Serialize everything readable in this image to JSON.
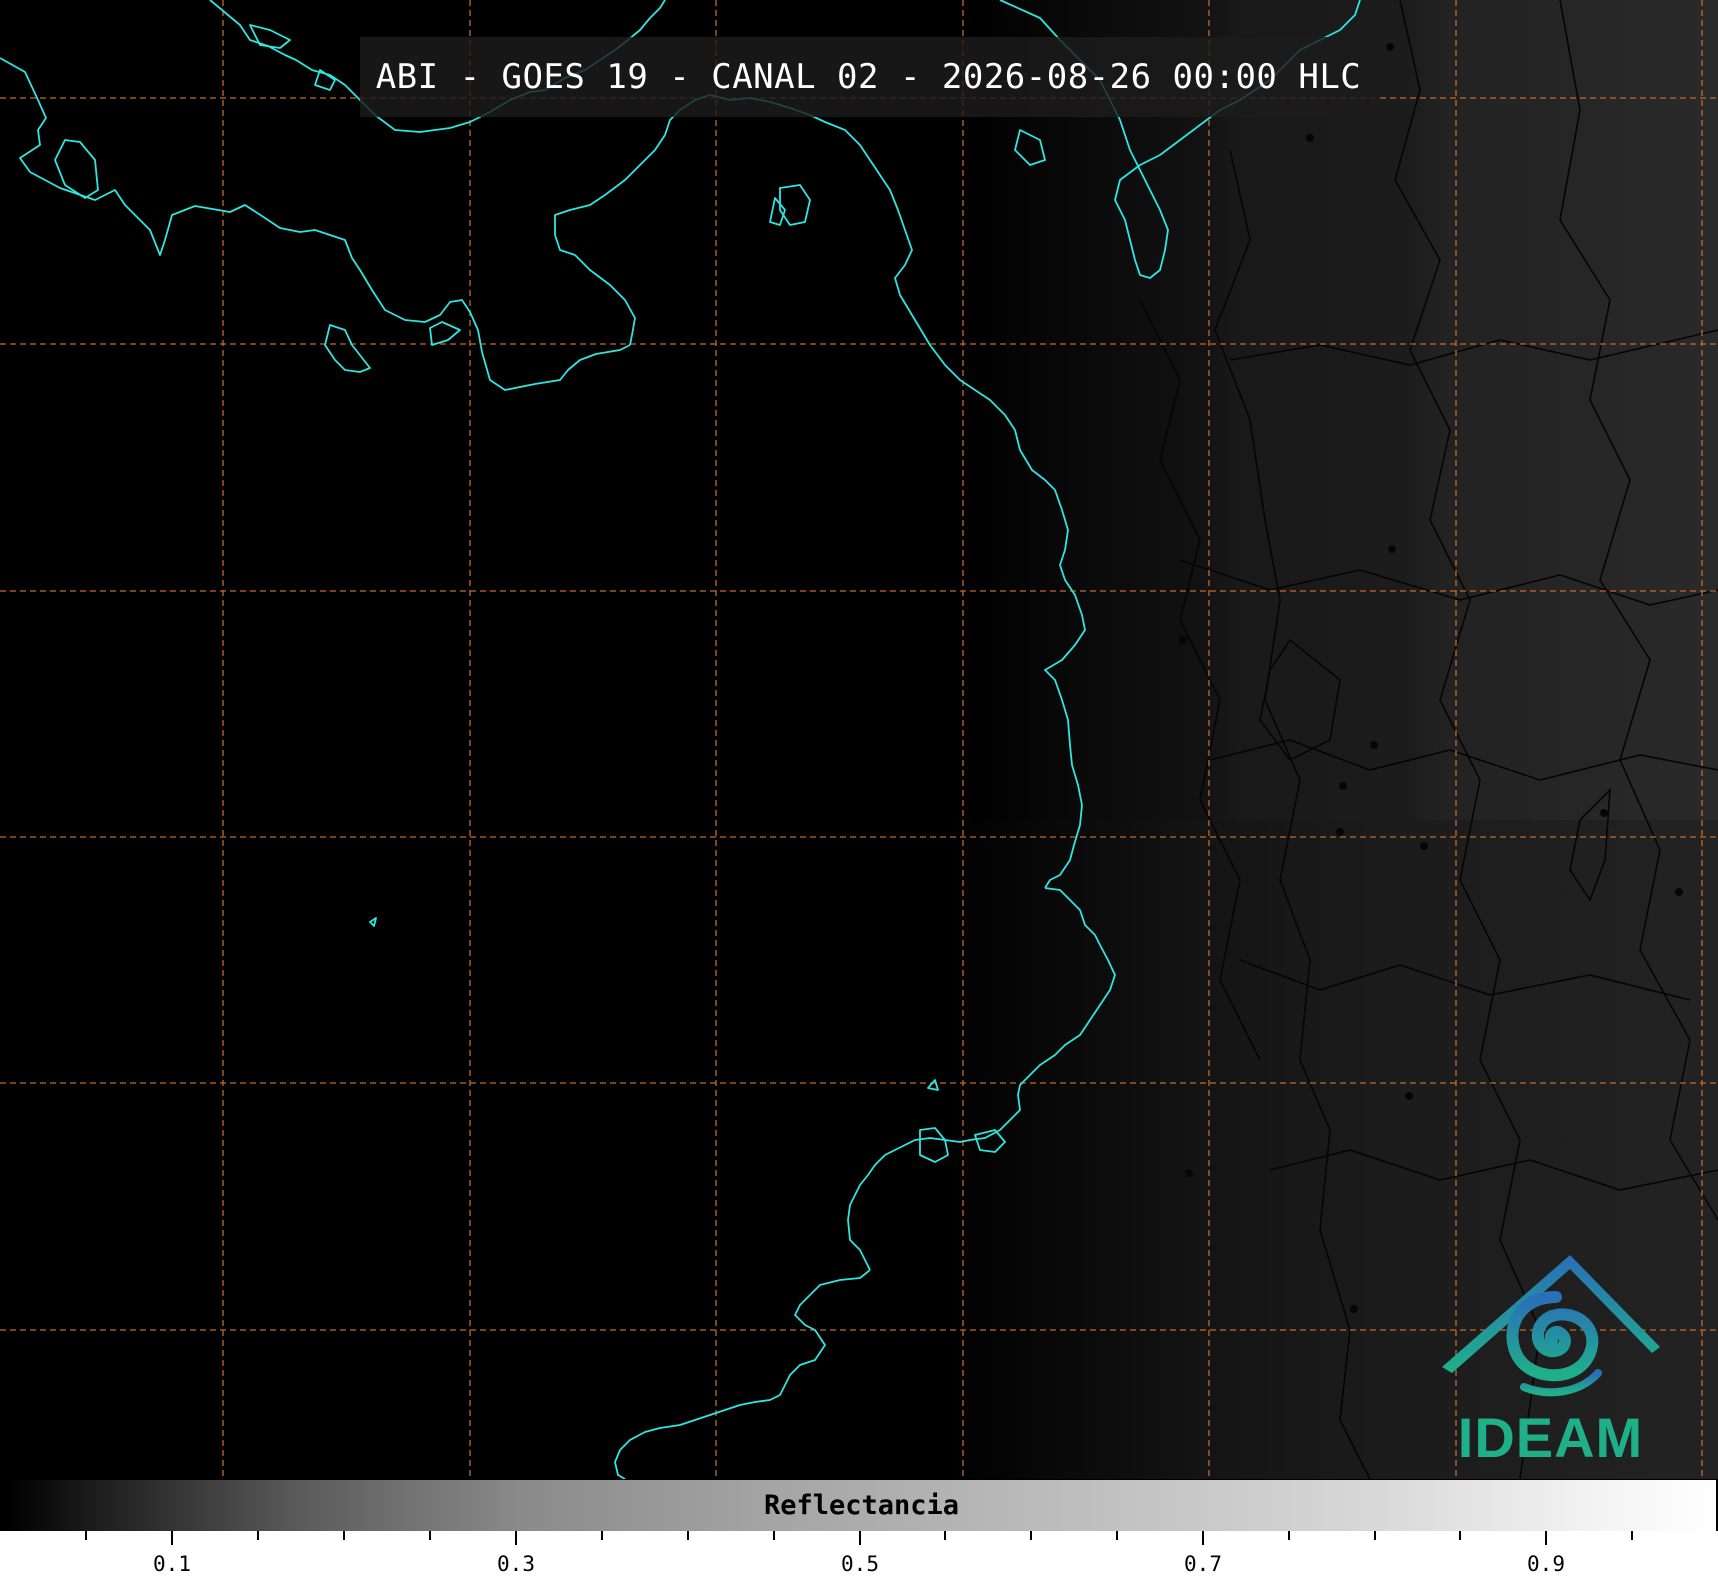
{
  "title": "ABI - GOES 19 - CANAL 02 - 2026-08-26 00:00 HLC",
  "colorbar": {
    "label": "Reflectancia",
    "tick_labels": [
      "0.1",
      "0.3",
      "0.5",
      "0.7",
      "0.9"
    ],
    "range": [
      0.0,
      1.0
    ]
  },
  "logo": {
    "text": "IDEAM"
  },
  "colors": {
    "coastline": "#2ee6e0",
    "gridline": "#c26a2c",
    "borders": "#050505",
    "logo_green": "#1fb08a",
    "logo_blue": "#2a6fb8"
  }
}
